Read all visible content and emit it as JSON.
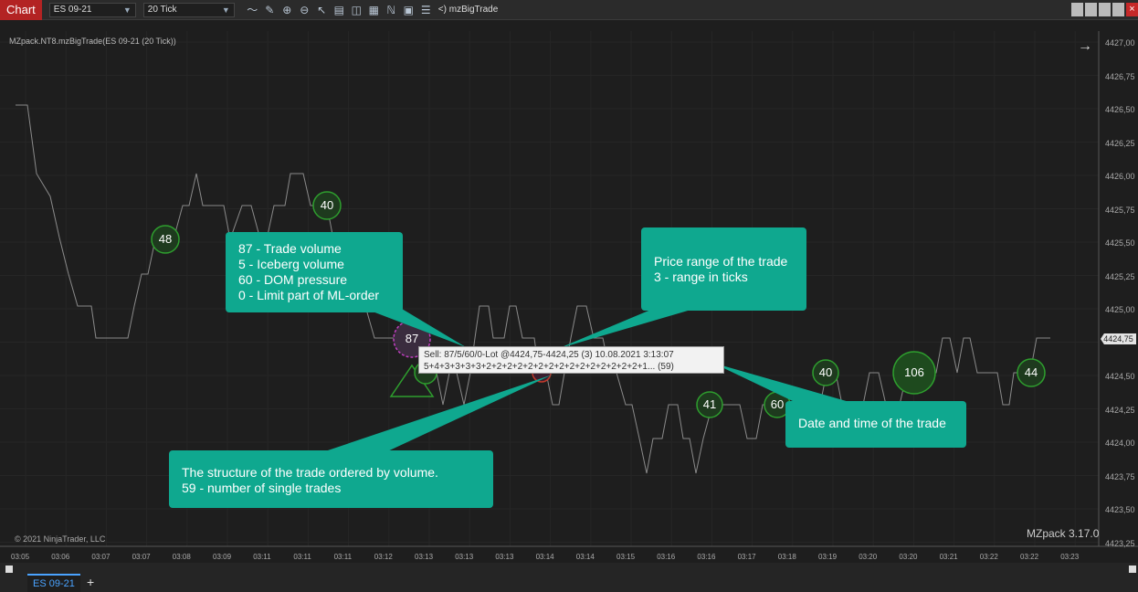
{
  "toolbar": {
    "chart_label": "Chart",
    "instrument": "ES 09-21",
    "interval": "20 Tick",
    "indicator_label": "<) mzBigTrade",
    "icons": [
      "line-draw-icon",
      "pencil-icon",
      "zoom-in-icon",
      "zoom-out-icon",
      "cursor-icon",
      "properties-icon",
      "templates-icon",
      "data-box-icon",
      "strategies-icon",
      "chart-trader-icon",
      "list-icon"
    ]
  },
  "study_label": "MZpack.NT8.mzBigTrade(ES 09-21 (20 Tick))",
  "price_axis": {
    "labels": [
      "4427,00",
      "4426,75",
      "4426,50",
      "4426,25",
      "4426,00",
      "4425,75",
      "4425,50",
      "4425,25",
      "4425,00",
      "4424,75",
      "4424,50",
      "4424,25",
      "4424,00",
      "4423,75",
      "4423,50",
      "4423,25"
    ],
    "current": "4424,75"
  },
  "time_axis": [
    "03:05",
    "03:06",
    "03:07",
    "03:07",
    "03:08",
    "03:09",
    "03:11",
    "03:11",
    "03:11",
    "03:12",
    "03:13",
    "03:13",
    "03:13",
    "03:14",
    "03:14",
    "03:15",
    "03:16",
    "03:16",
    "03:17",
    "03:18",
    "03:19",
    "03:20",
    "03:20",
    "03:21",
    "03:22",
    "03:22",
    "03:23"
  ],
  "trades": [
    {
      "label": "48",
      "price": 4425.5
    },
    {
      "label": "40",
      "price": 4425.75
    },
    {
      "label": "87",
      "price": 4424.75
    },
    {
      "label": "41",
      "price": 4424.25
    },
    {
      "label": "60",
      "price": 4424.25
    },
    {
      "label": "40",
      "price": 4424.5
    },
    {
      "label": "106",
      "price": 4424.5
    },
    {
      "label": "44",
      "price": 4424.5
    }
  ],
  "tooltip": {
    "line1": "Sell: 87/5/60/0-Lot  @4424,75-4424,25  (3)  10.08.2021  3:13:07",
    "line2": "5+4+3+3+3+3+2+2+2+2+2+2+2+2+2+2+2+2+2+2+2+1... (59)"
  },
  "callouts": {
    "legend": [
      "87 - Trade volume",
      "5 - Iceberg volume",
      "60 - DOM pressure",
      "0 - Limit part of ML-order"
    ],
    "price_range": [
      "Price range of the trade",
      "3 - range in ticks"
    ],
    "structure": [
      "The structure of the trade ordered by volume.",
      "59 - number of single trades"
    ],
    "datetime": [
      "Date and time of the trade"
    ]
  },
  "copyright": "© 2021 NinjaTrader, LLC",
  "brand": "MZpack 3.17.0",
  "bottom_tab": "ES 09-21",
  "add_tab": "+",
  "colors": {
    "background": "#1e1e1e",
    "callout": "#0fa88f",
    "chart_tab": "#b32323",
    "buy_bubble": "#2e9e2e",
    "sell_bubble": "#c03fc0",
    "tab_accent": "#4aa3ff"
  }
}
